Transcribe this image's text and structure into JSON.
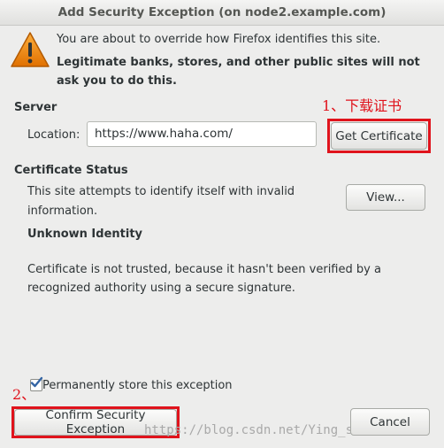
{
  "window": {
    "title": "Add Security Exception (on node2.example.com)"
  },
  "warning": {
    "icon": "warning-triangle-icon",
    "line1": "You are about to override how Firefox identifies this site.",
    "line2a": "Legitimate banks, stores, and other public sites will not",
    "line2b": "ask you to do this."
  },
  "server": {
    "heading": "Server",
    "location_label": "Location:",
    "location_value": "https://www.haha.com/",
    "get_cert_label": "Get Certificate"
  },
  "status": {
    "heading": "Certificate Status",
    "desc_a": "This site attempts to identify itself with invalid",
    "desc_b": "information.",
    "view_label": "View...",
    "identity_heading": "Unknown Identity",
    "trust_a": "Certificate is not trusted, because it hasn't been verified by a",
    "trust_b": "recognized authority using a secure signature."
  },
  "permanent": {
    "label": "Permanently store this exception",
    "checked": true
  },
  "footer": {
    "confirm_label": "Confirm Security Exception",
    "cancel_label": "Cancel"
  },
  "annotations": {
    "step1": "1、下载证书",
    "step2": "2、",
    "color": "#e0131c"
  },
  "watermark": "https://blog.csdn.net/Ying_smile"
}
